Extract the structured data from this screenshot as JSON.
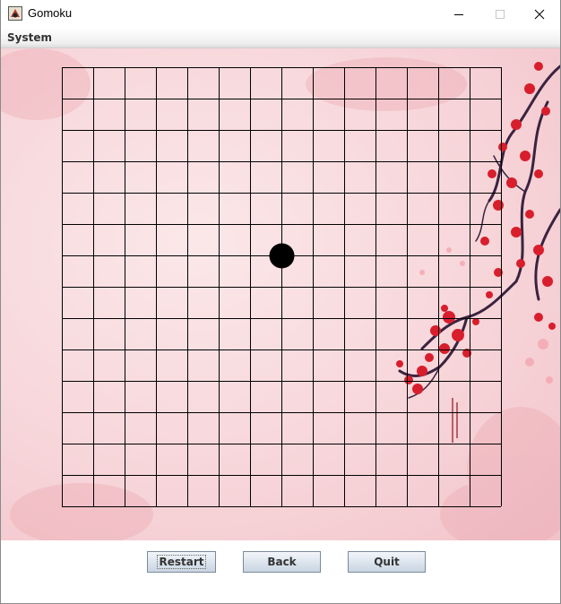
{
  "window": {
    "title": "Gomoku"
  },
  "menubar": {
    "items": [
      {
        "label": "System"
      }
    ]
  },
  "board": {
    "grid_size": 15,
    "stones": [
      {
        "color": "black",
        "row": 6,
        "col": 7
      }
    ]
  },
  "buttons": {
    "restart": "Restart",
    "back": "Back",
    "quit": "Quit"
  },
  "colors": {
    "board_background": "#f7d6da",
    "grid_line": "#000000",
    "blossom": "#d81e2c",
    "branch": "#3b2340"
  },
  "icons": {
    "app": "gomoku-app-icon",
    "minimize": "minimize-icon",
    "maximize": "maximize-icon",
    "close": "close-icon"
  }
}
